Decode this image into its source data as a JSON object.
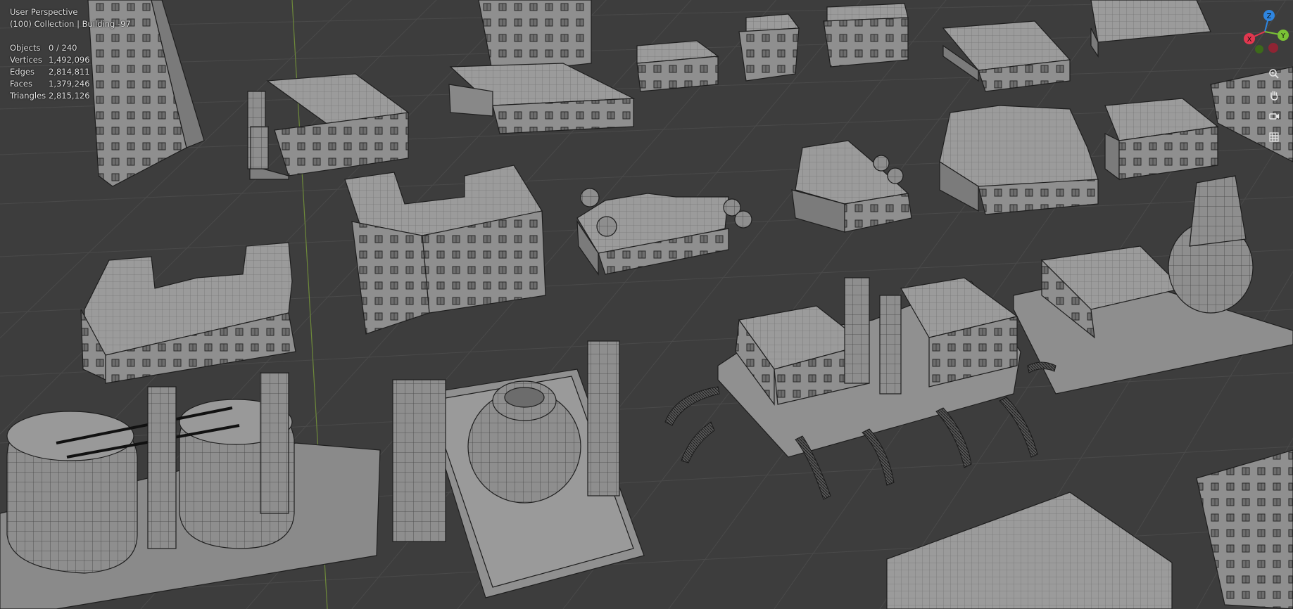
{
  "overlay": {
    "view_name": "User Perspective",
    "context": "(100) Collection | Building -97",
    "stats": [
      {
        "label": "Objects",
        "value": "0 / 240"
      },
      {
        "label": "Vertices",
        "value": "1,492,096"
      },
      {
        "label": "Edges",
        "value": "2,814,811"
      },
      {
        "label": "Faces",
        "value": "1,379,246"
      },
      {
        "label": "Triangles",
        "value": "2,815,126"
      }
    ]
  },
  "gizmo": {
    "z_label": "Z",
    "x_label": "X",
    "y_label": "Y",
    "colors": {
      "x": "#e2374f",
      "y": "#7ac235",
      "z": "#2e85e0"
    }
  },
  "nav": {
    "zoom_icon": "zoom-icon",
    "pan_icon": "hand-icon",
    "camera_icon": "camera-icon",
    "ortho_icon": "grid-icon"
  }
}
